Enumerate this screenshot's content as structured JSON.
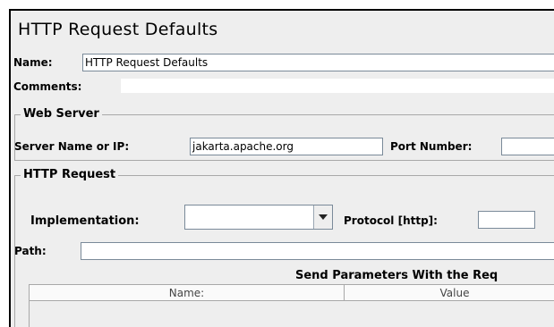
{
  "page": {
    "title": "HTTP Request Defaults"
  },
  "name_field": {
    "label": "Name:",
    "value": "HTTP Request Defaults"
  },
  "comments_field": {
    "label": "Comments:",
    "value": ""
  },
  "web_server": {
    "legend": "Web Server",
    "server_label": "Server Name or IP:",
    "server_value": "jakarta.apache.org",
    "port_label": "Port Number:",
    "port_value": ""
  },
  "http_request": {
    "legend": "HTTP Request",
    "implementation_label": "Implementation:",
    "implementation_value": "",
    "protocol_label": "Protocol [http]:",
    "protocol_value": "",
    "path_label": "Path:",
    "path_value": ""
  },
  "parameters": {
    "title": "Send Parameters With the Req",
    "columns": [
      "Name:",
      "Value"
    ]
  }
}
